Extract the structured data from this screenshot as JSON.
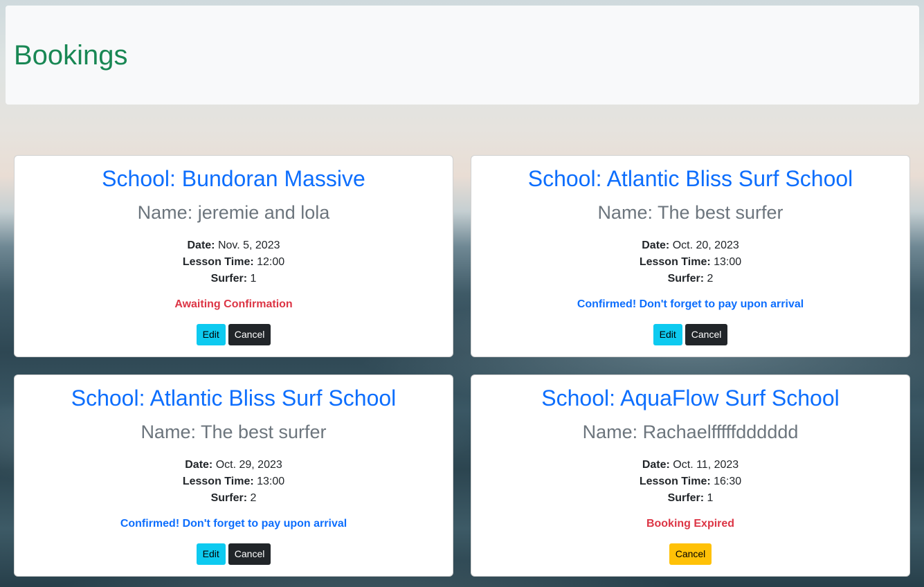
{
  "header": {
    "title": "Bookings"
  },
  "labels": {
    "date": "Date:",
    "lesson_time": "Lesson Time:",
    "surfer": "Surfer:",
    "edit": "Edit",
    "cancel": "Cancel"
  },
  "bookings": [
    {
      "school": "School: Bundoran Massive",
      "name": "Name: jeremie and lola",
      "date": "Nov. 5, 2023",
      "lesson_time": "12:00",
      "surfer": "1",
      "status": "Awaiting Confirmation"
    },
    {
      "school": "School: Atlantic Bliss Surf School",
      "name": "Name: The best surfer",
      "date": "Oct. 20, 2023",
      "lesson_time": "13:00",
      "surfer": "2",
      "status": "Confirmed! Don't forget to pay upon arrival"
    },
    {
      "school": "School: Atlantic Bliss Surf School",
      "name": "Name: The best surfer",
      "date": "Oct. 29, 2023",
      "lesson_time": "13:00",
      "surfer": "2",
      "status": "Confirmed! Don't forget to pay upon arrival"
    },
    {
      "school": "School: AquaFlow Surf School",
      "name": "Name: Rachaelfffffdddddd",
      "date": "Oct. 11, 2023",
      "lesson_time": "16:30",
      "surfer": "1",
      "status": "Booking Expired"
    }
  ],
  "colors": {
    "title": "#198754",
    "school": "#0d6efd",
    "status_pending": "#dc3545",
    "status_confirmed": "#0d6efd",
    "status_expired": "#dc3545",
    "edit_button": "#0dcaf0",
    "cancel_button": "#212529",
    "cancel_warning_button": "#ffc107"
  }
}
